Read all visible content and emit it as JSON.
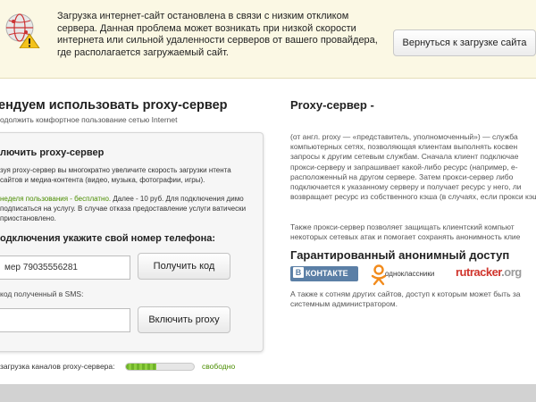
{
  "banner": {
    "message": "Загрузка интернет-сайт остановлена в связи с низким откликом сервера. Данная проблема может возникать при низкой скорости интернета или сильной удаленности серверов от вашего провайдера, где располагается загружаемый сайт.",
    "back_button": "Вернуться к загрузке сайта"
  },
  "left": {
    "title": "ендуем использовать proxy-сервер",
    "subtitle": "одолжить комфортное пользование сетью Internet",
    "panel": {
      "title": "лючить proxy-сервер",
      "p1": "зуя proxy-сервер вы многократно увеличите скорость загрузки нтента сайтов и медиа-контента (видео, музыка, фотографии, игры).",
      "p2_green": "неделя пользования - бесплатно.",
      "p2_rest": " Далее - 10 руб. Для подключения димо подписаться на услугу. В случае отказа предоставление услуги ватически приостановлено.",
      "phone_label": "одключения укажите свой номер телефона:",
      "phone_value": "мер 79035556281",
      "get_code": "Получить код",
      "sms_label": "код полученный в SMS:",
      "enable": "Включить proxy"
    },
    "loading": {
      "label": "загрузка каналов proxy-сервера:",
      "status": "свободно",
      "progress_percent": 45
    }
  },
  "right": {
    "title": "Proxy-сервер -",
    "p1": "(от англ. proxy — «представитель, уполномоченный») — служба компьютерных сетях, позволяющая клиентам выполнять косвен запросы к другим сетевым службам. Сначала клиент подключае прокси-серверу и запрашивает какой-либо ресурс (например, е- расположенный на другом сервере. Затем прокси-сервер либо подключается к указанному серверу и получает ресурс у него, ли возвращает ресурс из собственного кэша (в случаях, если прокси кэш).",
    "p2": "Также прокси-сервер позволяет защищать клиентский компьют некоторых сетевых атак и помогает сохранять анонимность клие",
    "anon_title": "Гарантированный анонимный доступ",
    "logos": {
      "vk": "КОНТАКТЕ",
      "vk_box": "В",
      "ok": "одноклассники",
      "rt_main": "rutracker",
      "rt_dim": ".org"
    },
    "p3": "А также к сотням других сайтов, доступ к которым может быть за системным администратором."
  },
  "colors": {
    "banner_bg": "#fbf8e4",
    "green": "#4a8d00",
    "vk_blue": "#5b7fa6",
    "rutracker_red": "#d0342c"
  }
}
